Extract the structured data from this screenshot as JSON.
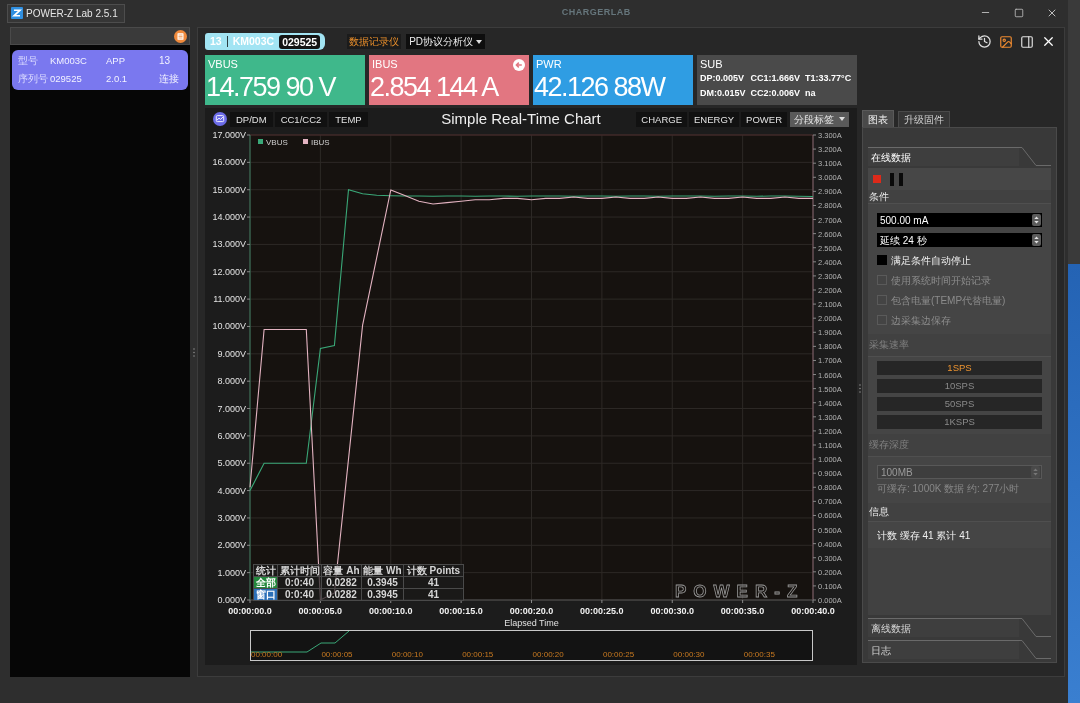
{
  "window": {
    "title": "POWER-Z Lab 2.5.1",
    "brand": "CHARGERLAB"
  },
  "devices": [
    {
      "selected": true,
      "rows": [
        [
          "型号",
          "KM003C",
          "APP",
          "13"
        ],
        [
          "序列号",
          "029525",
          "2.0.1",
          "连接"
        ]
      ]
    }
  ],
  "device_tag": {
    "port": "13",
    "model": "KM003C",
    "serial": "029525"
  },
  "mode_tabs": [
    {
      "kind": "tab",
      "label": "数据记录仪",
      "selected": true
    },
    {
      "kind": "dropdown",
      "label": "PD协议分析仪",
      "selected": false
    }
  ],
  "readings": [
    {
      "kind": "value",
      "label": "VBUS",
      "value": "14.759 90 V",
      "color": "#3fb88b"
    },
    {
      "kind": "switchable",
      "label": "IBUS",
      "value": "2.854 144 A",
      "color": "#e27681"
    },
    {
      "kind": "value",
      "label": "PWR",
      "value": "42.126 88W",
      "color": "#2f9de3"
    },
    {
      "kind": "sub",
      "label": "SUB",
      "color": "#4a4a4a",
      "lines": [
        [
          "DP:0.005V",
          "CC1:1.666V",
          "T1:33.77°C"
        ],
        [
          "DM:0.015V",
          "CC2:0.006V",
          "na"
        ]
      ]
    }
  ],
  "chart_panel": {
    "left_buttons": [
      "DP/DM",
      "CC1/CC2",
      "TEMP"
    ],
    "right_buttons": [
      "CHARGE",
      "ENERGY",
      "POWER"
    ],
    "tag_dropdown": "分段标签",
    "logo": "POWER-Z",
    "chart_data": [
      {
        "type": "line",
        "title": "Simple Real-Time Chart",
        "xlabel": "Elapsed Time",
        "legend": "top-left",
        "grid": true,
        "categories": [
          "00:00:00.0",
          null,
          null,
          null,
          null,
          "00:00:05.0",
          null,
          null,
          null,
          null,
          "00:00:10.0",
          null,
          null,
          null,
          null,
          "00:00:15.0",
          null,
          null,
          null,
          null,
          "00:00:20.0",
          null,
          null,
          null,
          null,
          "00:00:25.0",
          null,
          null,
          null,
          null,
          "00:00:30.0",
          null,
          null,
          null,
          null,
          "00:00:35.0",
          null,
          null,
          null,
          null,
          "00:00:40.0"
        ],
        "ylim": [
          0,
          17
        ],
        "yticks": [
          {
            "value": 0,
            "label": "0.000V"
          },
          {
            "value": 1,
            "label": "1.000V"
          },
          {
            "value": 2,
            "label": "2.000V"
          },
          {
            "value": 3,
            "label": "3.000V"
          },
          {
            "value": 4,
            "label": "4.000V"
          },
          {
            "value": 5,
            "label": "5.000V"
          },
          {
            "value": 6,
            "label": "6.000V"
          },
          {
            "value": 7,
            "label": "7.000V"
          },
          {
            "value": 8,
            "label": "8.000V"
          },
          {
            "value": 9,
            "label": "9.000V"
          },
          {
            "value": 10,
            "label": "10.000V"
          },
          {
            "value": 11,
            "label": "11.000V"
          },
          {
            "value": 12,
            "label": "12.000V"
          },
          {
            "value": 13,
            "label": "13.000V"
          },
          {
            "value": 14,
            "label": "14.000V"
          },
          {
            "value": 15,
            "label": "15.000V"
          },
          {
            "value": 16,
            "label": "16.000V"
          },
          {
            "value": 17,
            "label": "17.000V"
          }
        ],
        "y2lim": [
          0,
          3.3
        ],
        "y2ticks": [
          {
            "value": 0,
            "label": "0.000A"
          },
          {
            "value": 0.1,
            "label": "0.100A"
          },
          {
            "value": 0.2,
            "label": "0.200A"
          },
          {
            "value": 0.3,
            "label": "0.300A"
          },
          {
            "value": 0.4,
            "label": "0.400A"
          },
          {
            "value": 0.5,
            "label": "0.500A"
          },
          {
            "value": 0.6,
            "label": "0.600A"
          },
          {
            "value": 0.7,
            "label": "0.700A"
          },
          {
            "value": 0.8,
            "label": "0.800A"
          },
          {
            "value": 0.9,
            "label": "0.900A"
          },
          {
            "value": 1.0,
            "label": "1.000A"
          },
          {
            "value": 1.1,
            "label": "1.100A"
          },
          {
            "value": 1.2,
            "label": "1.200A"
          },
          {
            "value": 1.3,
            "label": "1.300A"
          },
          {
            "value": 1.4,
            "label": "1.400A"
          },
          {
            "value": 1.5,
            "label": "1.500A"
          },
          {
            "value": 1.6,
            "label": "1.600A"
          },
          {
            "value": 1.7,
            "label": "1.700A"
          },
          {
            "value": 1.8,
            "label": "1.800A"
          },
          {
            "value": 1.9,
            "label": "1.900A"
          },
          {
            "value": 2.0,
            "label": "2.000A"
          },
          {
            "value": 2.1,
            "label": "2.100A"
          },
          {
            "value": 2.2,
            "label": "2.200A"
          },
          {
            "value": 2.3,
            "label": "2.300A"
          },
          {
            "value": 2.4,
            "label": "2.400A"
          },
          {
            "value": 2.5,
            "label": "2.500A"
          },
          {
            "value": 2.6,
            "label": "2.600A"
          },
          {
            "value": 2.7,
            "label": "2.700A"
          },
          {
            "value": 2.8,
            "label": "2.800A"
          },
          {
            "value": 2.9,
            "label": "2.900A"
          },
          {
            "value": 3.0,
            "label": "3.000A"
          },
          {
            "value": 3.1,
            "label": "3.100A"
          },
          {
            "value": 3.2,
            "label": "3.200A"
          },
          {
            "value": 3.3,
            "label": "3.300A"
          }
        ],
        "series": [
          {
            "name": "VBUS",
            "color": "#3aa878",
            "values": [
              4.0,
              5.0,
              5.0,
              5.0,
              5.0,
              9.2,
              9.3,
              15.0,
              14.85,
              14.8,
              14.78,
              14.77,
              14.77,
              14.76,
              14.77,
              14.77,
              14.76,
              14.77,
              14.77,
              14.76,
              14.77,
              14.77,
              14.77,
              14.76,
              14.77,
              14.77,
              14.76,
              14.77,
              14.77,
              14.76,
              14.77,
              14.77,
              14.77,
              14.76,
              14.77,
              14.77,
              14.76,
              14.77,
              14.77,
              14.76,
              14.75
            ]
          },
          {
            "name": "IBUS",
            "color": "#e3b3c1",
            "axis": "y2",
            "values": [
              0.8,
              1.92,
              1.92,
              1.92,
              1.92,
              0.0,
              0.05,
              1.0,
              1.95,
              2.43,
              2.91,
              2.87,
              2.83,
              2.81,
              2.82,
              2.83,
              2.84,
              2.84,
              2.85,
              2.85,
              2.84,
              2.85,
              2.85,
              2.86,
              2.85,
              2.85,
              2.86,
              2.85,
              2.85,
              2.86,
              2.85,
              2.85,
              2.86,
              2.85,
              2.85,
              2.86,
              2.85,
              2.85,
              2.86,
              2.85,
              2.85
            ]
          }
        ]
      }
    ],
    "stats": {
      "columns": [
        "统计",
        "累计时间",
        "容量 Ah",
        "能量 Wh",
        "计数 Points"
      ],
      "rows": [
        {
          "color": "#23883c",
          "cells": [
            "全部",
            "0:0:40",
            "0.0282",
            "0.3945",
            "41"
          ]
        },
        {
          "color": "#2b70b8",
          "cells": [
            "窗口",
            "0:0:40",
            "0.0282",
            "0.3945",
            "41"
          ]
        }
      ]
    },
    "navigator": {
      "labels": [
        "00:00:00",
        "00:00:05",
        "00:00:10",
        "00:00:15",
        "00:00:20",
        "00:00:25",
        "00:00:30",
        "00:00:35"
      ]
    }
  },
  "side_panel": {
    "tabs": [
      {
        "label": "图表",
        "selected": true
      },
      {
        "label": "升级固件",
        "selected": false
      }
    ],
    "sections": [
      {
        "title": "在线数据",
        "expanded": true
      },
      {
        "title": "离线数据",
        "expanded": false
      },
      {
        "title": "日志",
        "expanded": false
      }
    ],
    "groups": [
      {
        "kind": "conditions",
        "title": "条件",
        "disabled": false,
        "fields": [
          {
            "value": "500.00 mA"
          },
          {
            "value": "延续 24 秒"
          }
        ],
        "checkboxes": [
          {
            "label": "满足条件自动停止",
            "checked": false,
            "disabled": false
          },
          {
            "label": "使用系统时间开始记录",
            "checked": false,
            "disabled": true
          },
          {
            "label": "包含电量(TEMP代替电量)",
            "checked": false,
            "disabled": true
          },
          {
            "label": "边采集边保存",
            "checked": false,
            "disabled": true
          }
        ]
      },
      {
        "kind": "rate",
        "title": "采集速率",
        "disabled": true,
        "options": [
          {
            "label": "1SPS",
            "selected": true
          },
          {
            "label": "10SPS",
            "selected": false
          },
          {
            "label": "50SPS",
            "selected": false
          },
          {
            "label": "1KSPS",
            "selected": false
          }
        ]
      },
      {
        "kind": "cache",
        "title": "缓存深度",
        "disabled": true,
        "field": {
          "value": "100MB"
        },
        "note": "可缓存: 1000K 数据 约: 277小时"
      },
      {
        "kind": "info",
        "title": "信息",
        "disabled": false,
        "text": "计数 缓存 41 累计 41"
      }
    ]
  }
}
